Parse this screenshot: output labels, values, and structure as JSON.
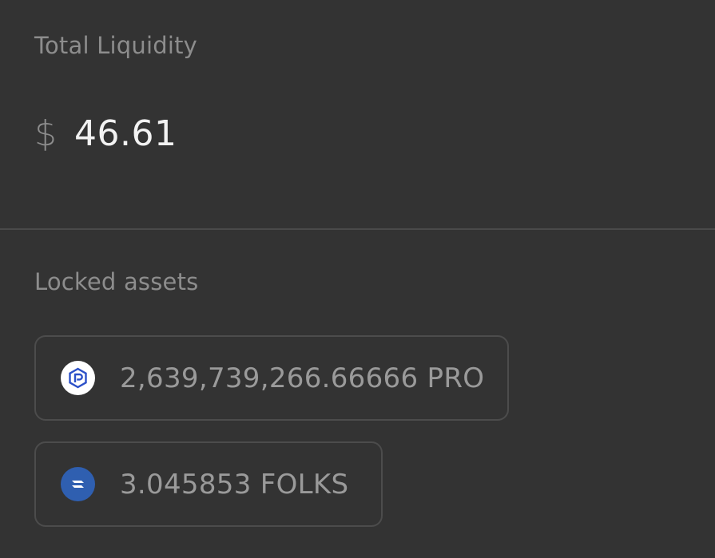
{
  "liquidity": {
    "label": "Total Liquidity",
    "currency_symbol": "$",
    "value": "46.61"
  },
  "locked": {
    "label": "Locked assets",
    "assets": [
      {
        "amount": "2,639,739,266.66666 PRO",
        "icon": "pro-token-icon"
      },
      {
        "amount": "3.045853 FOLKS",
        "icon": "folks-token-icon"
      }
    ]
  },
  "colors": {
    "background": "#333333",
    "divider": "#4a4a4a",
    "pro_icon_fg": "#2b50c8",
    "folks_icon_bg": "#2f5fb0"
  }
}
